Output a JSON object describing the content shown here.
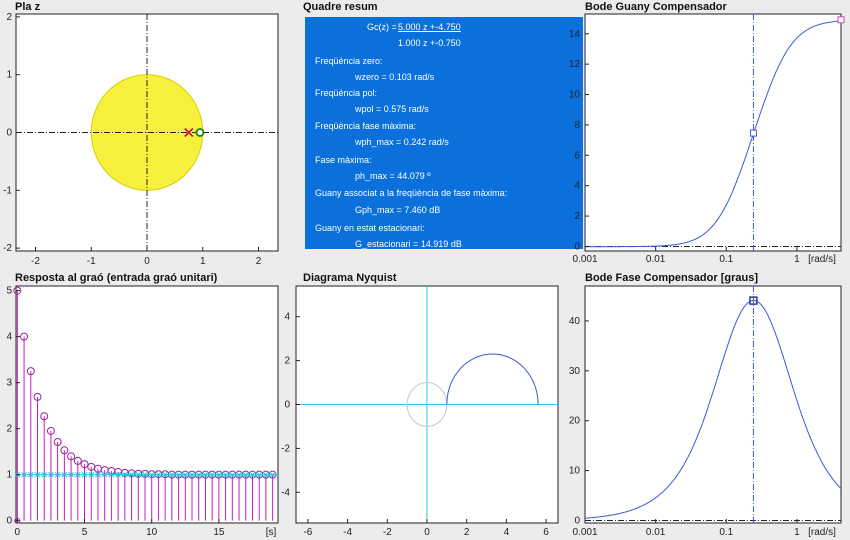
{
  "titles": {
    "pole_zero": "Pla z",
    "summary": "Quadre resum",
    "bode_gain": "Bode Guany Compensador",
    "step": "Resposta al graó (entrada graó unitari)",
    "nyquist": "Diagrama Nyquist",
    "bode_phase": "Bode Fase Compensador [graus]"
  },
  "summary": {
    "gc_label": "Gc(z) =",
    "numerator": "5.000 z +-4.750",
    "denominator": "1.000 z +-0.750",
    "zero_freq_label": "Freqüència zero:",
    "zero_freq_value": "wzero = 0.103 rad/s",
    "pole_freq_label": "Freqüència pol:",
    "pole_freq_value": "wpol = 0.575 rad/s",
    "max_phase_freq_label": "Freqüència fase màxima:",
    "max_phase_freq_value": "wph_max = 0.242 rad/s",
    "max_phase_label": "Fase màxima:",
    "max_phase_value": "ph_max = 44.079 º",
    "gain_at_max_label": "Guany associat a la freqüència de fase màxima:",
    "gain_at_max_value": "Gph_max = 7.460 dB",
    "static_gain_label": "Guany en estat estacionari:",
    "static_gain_value": "G_estacionari = 14.919 dB"
  },
  "axes": {
    "pz_x_ticks": [
      "-2",
      "-1",
      "0",
      "1",
      "2"
    ],
    "pz_y_ticks": [
      "2",
      "1",
      "0",
      "-1",
      "-2"
    ],
    "bg_y_ticks": [
      "14",
      "12",
      "10",
      "8",
      "6",
      "4",
      "2",
      "0"
    ],
    "bode_x_ticks": [
      "0.001",
      "0.01",
      "0.1",
      "1"
    ],
    "freq_unit": "[rad/s]",
    "step_y_ticks": [
      "5",
      "4",
      "3",
      "2",
      "1",
      "0"
    ],
    "step_x_ticks": [
      "0",
      "5",
      "10",
      "15"
    ],
    "time_unit": "[s]",
    "ny_y_ticks": [
      "4",
      "2",
      "0",
      "-2",
      "-4"
    ],
    "ny_x_ticks": [
      "-6",
      "-4",
      "-2",
      "0",
      "2",
      "4",
      "6"
    ],
    "bp_y_ticks": [
      "40",
      "30",
      "20",
      "10",
      "0"
    ]
  },
  "chart_data": [
    {
      "type": "scatter",
      "name": "pole_zero_map",
      "xlim": [
        -2.35,
        2.35
      ],
      "ylim": [
        -2.05,
        2.05
      ],
      "unit_circle_radius": 1,
      "poles": [
        [
          0.75,
          0
        ]
      ],
      "zeros": [
        [
          0.95,
          0
        ]
      ]
    },
    {
      "type": "line",
      "name": "bode_gain",
      "x_scale": "log",
      "xlim": [
        0.001,
        4.2
      ],
      "ylim": [
        -0.3,
        15.3
      ],
      "w_zero": 0.103,
      "w_pole": 0.575,
      "static_gain_db": 14.919,
      "marker": [
        0.242,
        7.46
      ]
    },
    {
      "type": "scatter",
      "name": "step_response",
      "xlim": [
        -0.1,
        19.4
      ],
      "ylim": [
        -0.05,
        5.1
      ],
      "t": [
        0,
        0.5,
        1,
        1.5,
        2,
        2.5,
        3,
        3.5,
        4,
        4.5,
        5,
        5.5,
        6,
        6.5,
        7,
        7.5,
        8,
        8.5,
        9,
        9.5,
        10,
        10.5,
        11,
        11.5,
        12,
        12.5,
        13,
        13.5,
        14,
        14.5,
        15,
        15.5,
        16,
        16.5,
        17,
        17.5,
        18,
        18.5,
        19
      ],
      "values": [
        5,
        4,
        3.25,
        2.69,
        2.27,
        1.95,
        1.71,
        1.53,
        1.4,
        1.3,
        1.23,
        1.17,
        1.13,
        1.1,
        1.08,
        1.06,
        1.04,
        1.03,
        1.02,
        1.02,
        1.01,
        1.01,
        1.01,
        1,
        1,
        1,
        1,
        1,
        1,
        1,
        1,
        1,
        1,
        1,
        1,
        1,
        1,
        1,
        1
      ],
      "reference": 1
    },
    {
      "type": "line",
      "name": "nyquist",
      "xlim": [
        -6.6,
        6.6
      ],
      "ylim": [
        -5.4,
        5.4
      ],
      "unit_circle_radius": 1,
      "arc_real_range": [
        1.0,
        5.6
      ]
    },
    {
      "type": "line",
      "name": "bode_phase",
      "x_scale": "log",
      "xlim": [
        0.001,
        4.2
      ],
      "ylim": [
        -0.5,
        47
      ],
      "w_zero": 0.103,
      "w_pole": 0.575,
      "marker": [
        0.242,
        44.079
      ]
    }
  ]
}
